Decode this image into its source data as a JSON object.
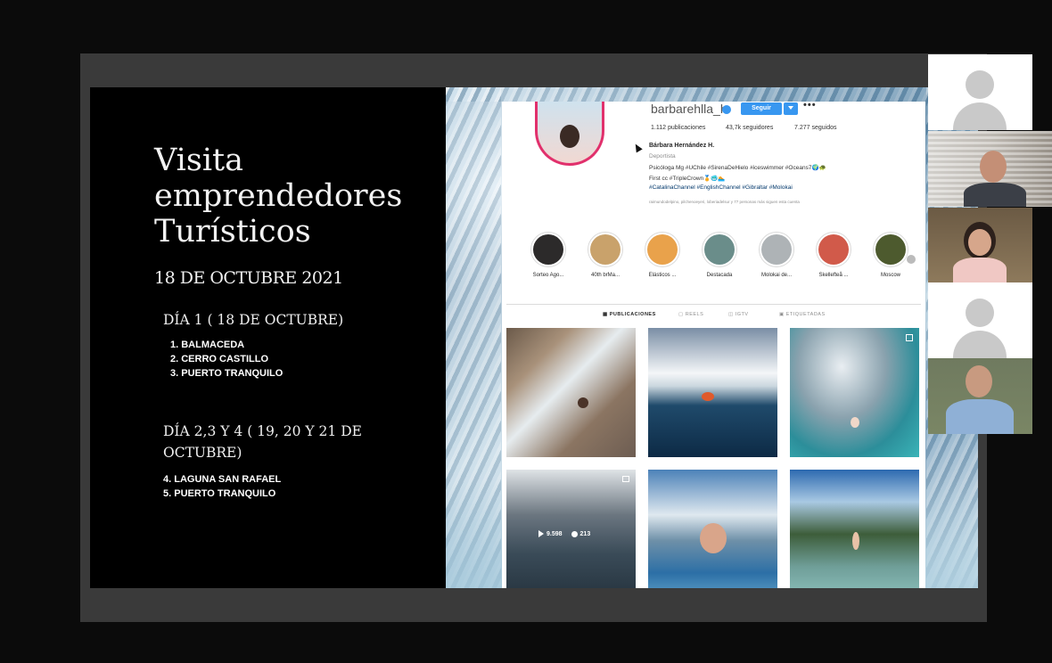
{
  "slide": {
    "title_lines": [
      "Visita",
      "emprendedores",
      "Turísticos"
    ],
    "date": "18 DE OCTUBRE 2021",
    "day1": {
      "heading": "DÍA 1 ( 18 DE OCTUBRE)",
      "places": [
        "1. BALMACEDA",
        "2. CERRO CASTILLO",
        "3. PUERTO TRANQUILO"
      ]
    },
    "day2": {
      "heading": "DÍA 2,3 Y 4 ( 19, 20 Y 21 DE OCTUBRE)",
      "places": [
        "4. LAGUNA SAN RAFAEL",
        "5. PUERTO TRANQUILO"
      ]
    }
  },
  "instagram": {
    "username": "barbarehlla_h",
    "follow_label": "Seguir",
    "more": "•••",
    "stats": {
      "posts": "1.112 publicaciones",
      "followers": "43,7k seguidores",
      "following": "7.277 seguidos"
    },
    "bio": {
      "name": "Bárbara Hernández H.",
      "category": "Deportista",
      "line1": "Psicóloga Mg #UChile #SirenaDeHielo #iceswimmer #Oceans7🌍🐢",
      "line2": "First cc #TripleCrown🏅🥶🏊",
      "line3": "#CatalinaChannel #EnglishChannel #Gibraltar #Molokai",
      "followed_by": "raimundodelpino, pilchenoeyeri, loberiadelsur y 77 personas más siguen esta cuenta"
    },
    "highlights": [
      {
        "label": "Sorteo Ago...",
        "color": "#2c2a2a"
      },
      {
        "label": "40th brMa...",
        "color": "#c9a26b"
      },
      {
        "label": "Elásticos ...",
        "color": "#e9a24b"
      },
      {
        "label": "Destacada",
        "color": "#6a8d8a"
      },
      {
        "label": "Molokai de...",
        "color": "#aeb3b6"
      },
      {
        "label": "Skellefteå ...",
        "color": "#d15a4a"
      },
      {
        "label": "Moscow",
        "color": "#4d5a2e"
      }
    ],
    "tabs": {
      "posts": "▦ PUBLICACIONES",
      "reels": "▢ REELS",
      "igtv": "◫ IGTV",
      "tagged": "▣ ETIQUETADAS"
    },
    "post4_overlay": {
      "views": "9.598",
      "comments": "213"
    }
  }
}
